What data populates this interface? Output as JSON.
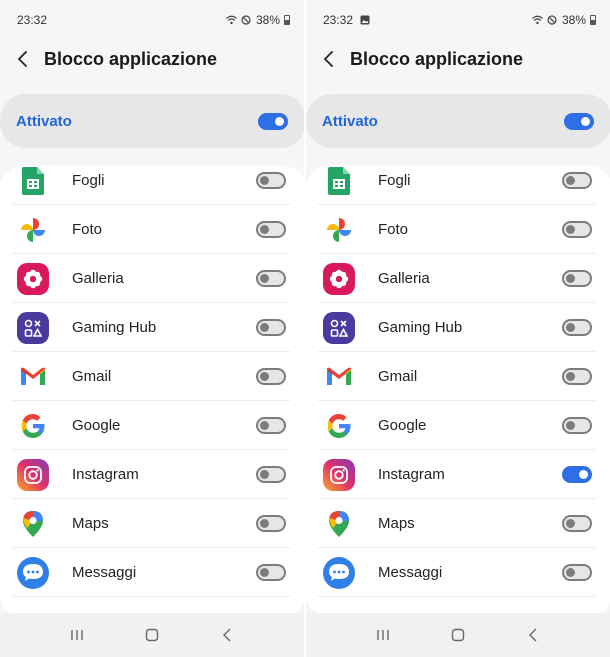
{
  "screens": [
    {
      "status": {
        "time": "23:32",
        "battery": "38%",
        "has_image_notification": false
      },
      "title": "Blocco applicazione",
      "master": {
        "label": "Attivato",
        "enabled": true
      },
      "apps": [
        {
          "name": "Fogli",
          "icon": "sheets-icon",
          "enabled": false
        },
        {
          "name": "Foto",
          "icon": "photos-icon",
          "enabled": false
        },
        {
          "name": "Galleria",
          "icon": "gallery-icon",
          "enabled": false
        },
        {
          "name": "Gaming Hub",
          "icon": "gaming-hub-icon",
          "enabled": false
        },
        {
          "name": "Gmail",
          "icon": "gmail-icon",
          "enabled": false
        },
        {
          "name": "Google",
          "icon": "google-icon",
          "enabled": false
        },
        {
          "name": "Instagram",
          "icon": "instagram-icon",
          "enabled": false
        },
        {
          "name": "Maps",
          "icon": "maps-icon",
          "enabled": false
        },
        {
          "name": "Messaggi",
          "icon": "messages-icon",
          "enabled": false
        }
      ]
    },
    {
      "status": {
        "time": "23:32",
        "battery": "38%",
        "has_image_notification": true
      },
      "title": "Blocco applicazione",
      "master": {
        "label": "Attivato",
        "enabled": true
      },
      "apps": [
        {
          "name": "Fogli",
          "icon": "sheets-icon",
          "enabled": false
        },
        {
          "name": "Foto",
          "icon": "photos-icon",
          "enabled": false
        },
        {
          "name": "Galleria",
          "icon": "gallery-icon",
          "enabled": false
        },
        {
          "name": "Gaming Hub",
          "icon": "gaming-hub-icon",
          "enabled": false
        },
        {
          "name": "Gmail",
          "icon": "gmail-icon",
          "enabled": false
        },
        {
          "name": "Google",
          "icon": "google-icon",
          "enabled": false
        },
        {
          "name": "Instagram",
          "icon": "instagram-icon",
          "enabled": true
        },
        {
          "name": "Maps",
          "icon": "maps-icon",
          "enabled": false
        },
        {
          "name": "Messaggi",
          "icon": "messages-icon",
          "enabled": false
        }
      ]
    }
  ],
  "colors": {
    "accent": "#2f6fe6",
    "master_label": "#2166d8"
  }
}
